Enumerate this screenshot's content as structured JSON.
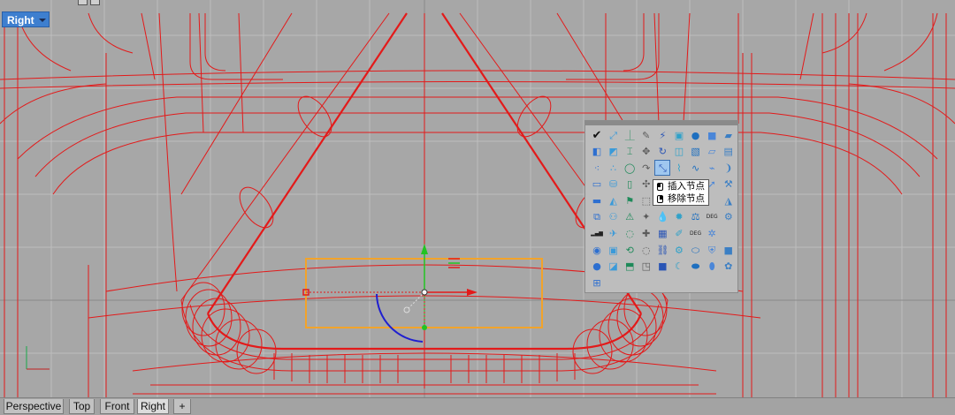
{
  "viewport": {
    "name": "Right",
    "grid_color": "#bcbcbc",
    "curve_color": "#e01616",
    "gumball": {
      "x_color": "#e01616",
      "y_color": "#22c422",
      "z_color": "#1f1fd0",
      "box_color": "#f2a32a"
    }
  },
  "toolbar": {
    "buttons": [
      {
        "icon": "check-icon",
        "glyph": "✔"
      },
      {
        "icon": "zoom-extents-icon",
        "glyph": "⤢"
      },
      {
        "icon": "pin-icon",
        "glyph": "⏊"
      },
      {
        "icon": "pencil-icon",
        "glyph": "✎"
      },
      {
        "icon": "wand-icon",
        "glyph": "⚡"
      },
      {
        "icon": "cube-icon",
        "glyph": "▣"
      },
      {
        "icon": "sphere-icon",
        "glyph": "●"
      },
      {
        "icon": "cube-blue-icon",
        "glyph": "■"
      },
      {
        "icon": "surface-icon",
        "glyph": "▰"
      },
      {
        "icon": "layers-icon",
        "glyph": "◧"
      },
      {
        "icon": "surface-edit-icon",
        "glyph": "◩"
      },
      {
        "icon": "bracket-icon",
        "glyph": "⌶"
      },
      {
        "icon": "rebuild-icon",
        "glyph": "✥"
      },
      {
        "icon": "loop-icon",
        "glyph": "↻"
      },
      {
        "icon": "patch-icon",
        "glyph": "◫"
      },
      {
        "icon": "blend-icon",
        "glyph": "▧"
      },
      {
        "icon": "plane-icon",
        "glyph": "▱"
      },
      {
        "icon": "extrude-icon",
        "glyph": "▤"
      },
      {
        "icon": "points-icon",
        "glyph": "⁖"
      },
      {
        "icon": "curve-points-icon",
        "glyph": "∴"
      },
      {
        "icon": "circle-icon",
        "glyph": "◯"
      },
      {
        "icon": "arc-icon",
        "glyph": "↷"
      },
      {
        "icon": "insert-knot-icon",
        "glyph": "⤡"
      },
      {
        "icon": "polyline-icon",
        "glyph": "⌇"
      },
      {
        "icon": "wave-icon",
        "glyph": "∿"
      },
      {
        "icon": "hook-icon",
        "glyph": "⌁"
      },
      {
        "icon": "bracket-curve-icon",
        "glyph": "❩"
      },
      {
        "icon": "monitor-icon",
        "glyph": "▭"
      },
      {
        "icon": "bucket-icon",
        "glyph": "⛁"
      },
      {
        "icon": "door-icon",
        "glyph": "▯"
      },
      {
        "icon": "fan-icon",
        "glyph": "✣"
      },
      {
        "icon": "cube-small-icon",
        "glyph": "■"
      },
      {
        "icon": "frame-icon",
        "glyph": "▢"
      },
      {
        "icon": "frame-icon",
        "glyph": "▢"
      },
      {
        "icon": "arrow-icon",
        "glyph": "➚"
      },
      {
        "icon": "shovel-icon",
        "glyph": "⚒"
      },
      {
        "icon": "flat-surface-icon",
        "glyph": "▬"
      },
      {
        "icon": "blade-icon",
        "glyph": "◭"
      },
      {
        "icon": "flag-icon",
        "glyph": "⚑"
      },
      {
        "icon": "dotted-cube-icon",
        "glyph": "⬚"
      },
      {
        "icon": "blank-icon",
        "glyph": ""
      },
      {
        "icon": "blank-icon",
        "glyph": ""
      },
      {
        "icon": "blank-icon",
        "glyph": ""
      },
      {
        "icon": "blank-icon",
        "glyph": ""
      },
      {
        "icon": "blade-right-icon",
        "glyph": "◮"
      },
      {
        "icon": "stack-icon",
        "glyph": "⧉"
      },
      {
        "icon": "people-icon",
        "glyph": "⚇"
      },
      {
        "icon": "warning-icon",
        "glyph": "⚠"
      },
      {
        "icon": "bulb-blue-icon",
        "glyph": "✦"
      },
      {
        "icon": "drop-icon",
        "glyph": "💧"
      },
      {
        "icon": "star-icon",
        "glyph": "✹"
      },
      {
        "icon": "scale-icon",
        "glyph": "⚖"
      },
      {
        "icon": "degree-icon",
        "glyph": "DEG"
      },
      {
        "icon": "gear-blue-icon",
        "glyph": "⚙"
      },
      {
        "icon": "bar-chart-icon",
        "glyph": "▂▄▆"
      },
      {
        "icon": "plane-fly-icon",
        "glyph": "✈"
      },
      {
        "icon": "bulb-icon",
        "glyph": "◌"
      },
      {
        "icon": "move-arrows-icon",
        "glyph": "✚"
      },
      {
        "icon": "film-icon",
        "glyph": "▦"
      },
      {
        "icon": "paint-icon",
        "glyph": "✐"
      },
      {
        "icon": "degree-alt-icon",
        "glyph": "DEG"
      },
      {
        "icon": "cog-icon",
        "glyph": "✲"
      },
      {
        "icon": "blank-icon",
        "glyph": ""
      },
      {
        "icon": "globe-icon",
        "glyph": "◉"
      },
      {
        "icon": "camera-icon",
        "glyph": "▣"
      },
      {
        "icon": "loop-arrows-icon",
        "glyph": "⟲"
      },
      {
        "icon": "dotted-ring-icon",
        "glyph": "◌"
      },
      {
        "icon": "chain-icon",
        "glyph": "⛓"
      },
      {
        "icon": "gear-green-icon",
        "glyph": "⚙"
      },
      {
        "icon": "capsule-icon",
        "glyph": "⬭"
      },
      {
        "icon": "shield-icon",
        "glyph": "⛨"
      },
      {
        "icon": "cube-blue-icon",
        "glyph": "■"
      },
      {
        "icon": "sphere-blue-icon",
        "glyph": "●"
      },
      {
        "icon": "map-icon",
        "glyph": "◪"
      },
      {
        "icon": "bookmark-icon",
        "glyph": "⬒"
      },
      {
        "icon": "cube-open-icon",
        "glyph": "◳"
      },
      {
        "icon": "cube-solid-icon",
        "glyph": "■"
      },
      {
        "icon": "moon-icon",
        "glyph": "☾"
      },
      {
        "icon": "pipe-icon",
        "glyph": "⬬"
      },
      {
        "icon": "cylinder-icon",
        "glyph": "⬮"
      },
      {
        "icon": "cog-blue-icon",
        "glyph": "✿"
      },
      {
        "icon": "network-icon",
        "glyph": "⊞"
      }
    ]
  },
  "tooltip": {
    "line1": "插入节点",
    "line2": "移除节点"
  },
  "tabs": [
    {
      "label": "Perspective",
      "name": "tab-perspective"
    },
    {
      "label": "Top",
      "name": "tab-top"
    },
    {
      "label": "Front",
      "name": "tab-front"
    },
    {
      "label": "Right",
      "name": "tab-right"
    },
    {
      "label": "+",
      "name": "tab-add"
    }
  ]
}
